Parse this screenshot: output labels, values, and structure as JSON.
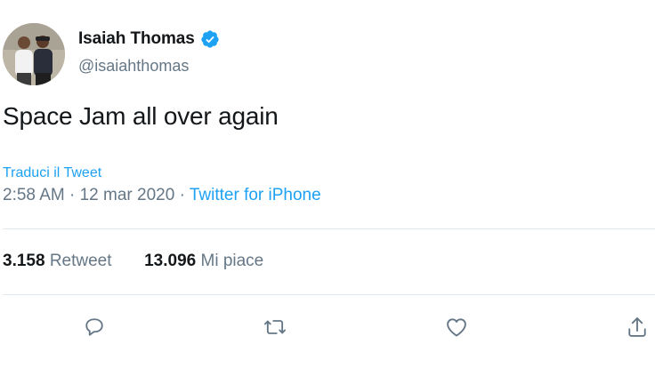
{
  "author": {
    "name": "Isaiah Thomas",
    "handle": "@isaiahthomas",
    "verified": true,
    "avatar_icon": "profile-photo-two-people"
  },
  "tweet": {
    "text": "Space Jam all over again",
    "translate_label": "Traduci il Tweet",
    "time": "2:58 AM",
    "date": "12 mar 2020",
    "separator": "·",
    "source": "Twitter for iPhone"
  },
  "stats": {
    "retweets_count": "3.158",
    "retweets_label": "Retweet",
    "likes_count": "13.096",
    "likes_label": "Mi piace"
  },
  "actions": [
    {
      "icon": "reply-icon"
    },
    {
      "icon": "retweet-icon"
    },
    {
      "icon": "like-heart-icon"
    },
    {
      "icon": "share-icon"
    }
  ],
  "colors": {
    "accent": "#1da1f2",
    "text_primary": "#14171a",
    "text_secondary": "#657786",
    "divider": "#e1e8ed"
  }
}
